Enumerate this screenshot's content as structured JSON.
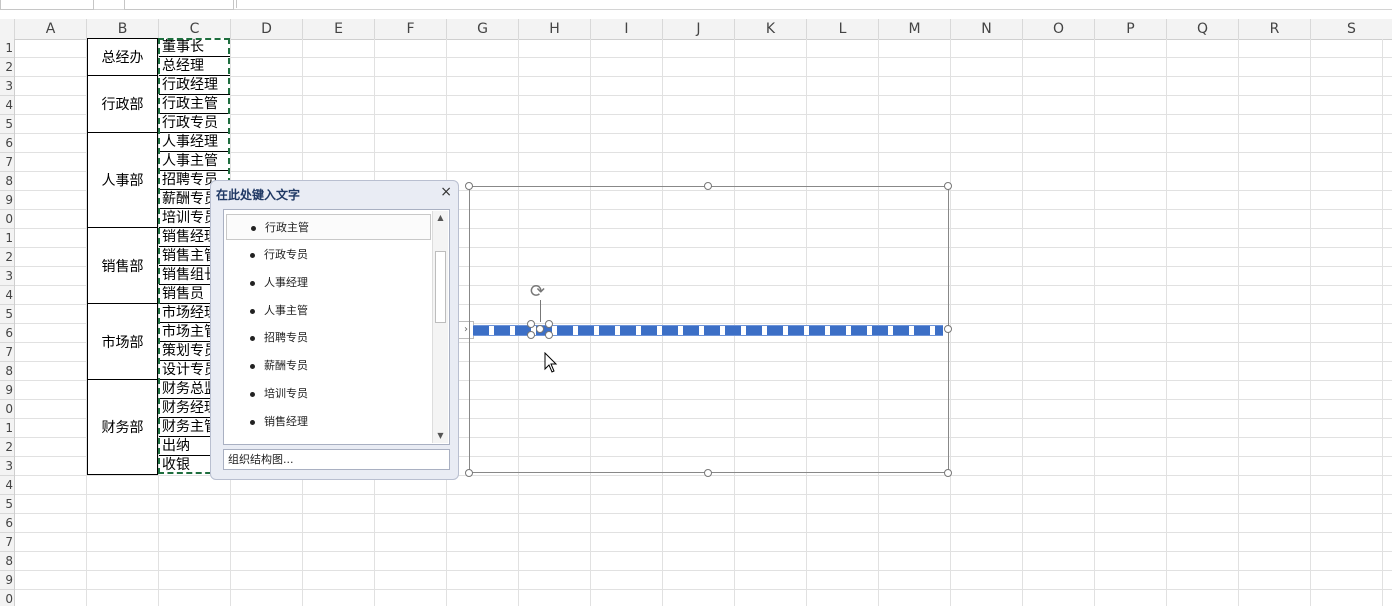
{
  "formula_bar": {
    "name_box": "",
    "function_box": "",
    "formula": ""
  },
  "columns": [
    "A",
    "B",
    "C",
    "D",
    "E",
    "F",
    "G",
    "H",
    "I",
    "J",
    "K",
    "L",
    "M",
    "N",
    "O",
    "P",
    "Q",
    "R",
    "S"
  ],
  "rows": [
    "1",
    "2",
    "3",
    "4",
    "5",
    "6",
    "7",
    "8",
    "9",
    "0",
    "1",
    "2",
    "3",
    "4",
    "5",
    "6",
    "7",
    "8",
    "9",
    "0",
    "1",
    "2",
    "3",
    "4",
    "5",
    "6",
    "7",
    "8",
    "9",
    "0"
  ],
  "departments": [
    "总经办",
    "行政部",
    "人事部",
    "销售部",
    "市场部",
    "财务部"
  ],
  "positions": [
    "董事长",
    "总经理",
    "行政经理",
    "行政主管",
    "行政专员",
    "人事经理",
    "人事主管",
    "招聘专员",
    "薪酬专员",
    "培训专员",
    "销售经理",
    "销售主管",
    "销售组长",
    "销售员",
    "市场经理",
    "市场主管",
    "策划专员",
    "设计专员",
    "财务总监",
    "财务经理",
    "财务主管",
    "出纳",
    "收银"
  ],
  "text_pane": {
    "title": "在此处键入文字",
    "close": "×",
    "items": [
      "行政主管",
      "行政专员",
      "人事经理",
      "人事主管",
      "招聘专员",
      "薪酬专员",
      "培训专员",
      "销售经理"
    ],
    "footer": "组织结构图...",
    "scroll_up": "▲",
    "scroll_down": "▼",
    "toggle": "›"
  },
  "rotate_icon": "⟳"
}
